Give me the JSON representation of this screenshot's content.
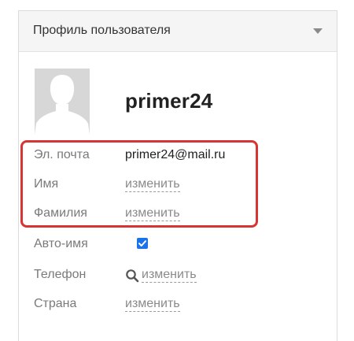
{
  "panel": {
    "title": "Профиль пользователя",
    "collapse_icon": "chevron-down-icon"
  },
  "user": {
    "avatar_icon": "user-silhouette-icon",
    "username": "primer24"
  },
  "fields": {
    "email": {
      "label": "Эл. почта",
      "value": "primer24@mail.ru"
    },
    "first_name": {
      "label": "Имя",
      "action": "изменить"
    },
    "last_name": {
      "label": "Фамилия",
      "action": "изменить"
    },
    "auto_name": {
      "label": "Авто-имя",
      "checked": true
    },
    "phone": {
      "label": "Телефон",
      "icon": "search-icon",
      "action": "изменить"
    },
    "country": {
      "label": "Страна",
      "action": "изменить"
    }
  },
  "colors": {
    "highlight": "#d93434",
    "checkbox": "#1a73e8"
  }
}
